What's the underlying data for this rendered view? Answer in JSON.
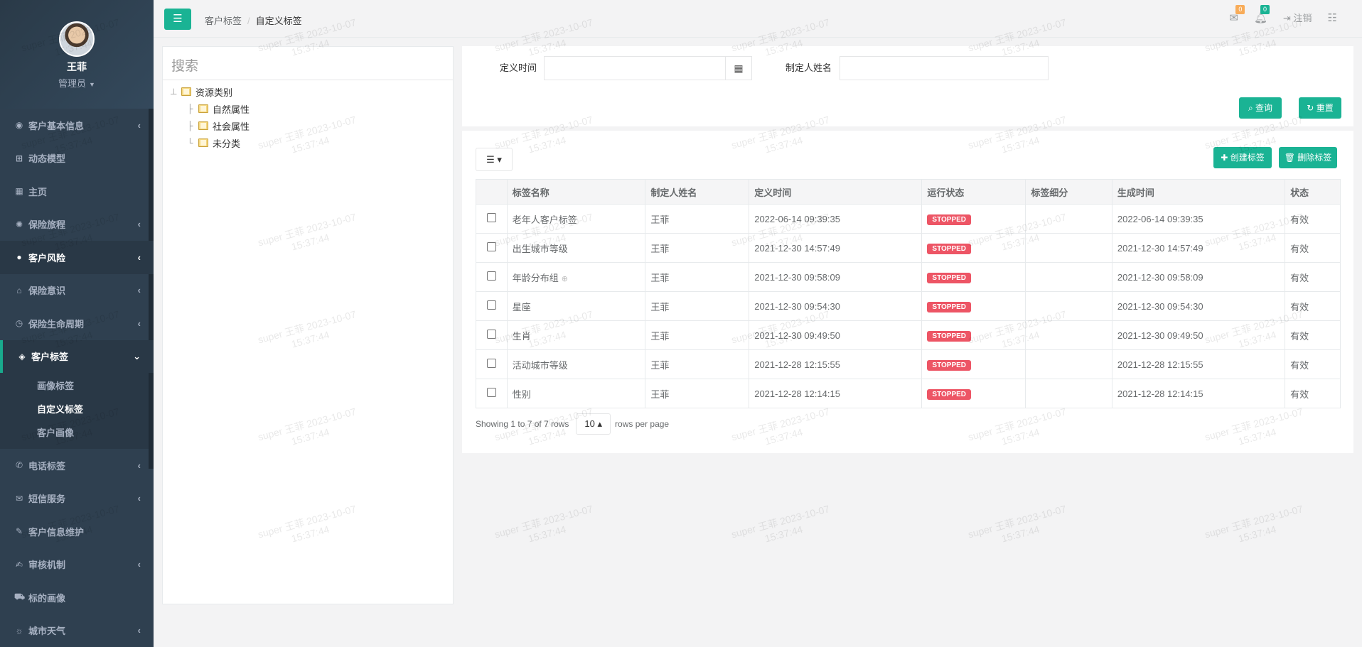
{
  "user": {
    "name": "王菲",
    "role": "管理员"
  },
  "nav": [
    {
      "label": "客户基本信息",
      "icon": "user-circle-icon",
      "glyph": "◉",
      "arrow": "‹",
      "state": ""
    },
    {
      "label": "动态模型",
      "icon": "sitemap-icon",
      "glyph": "⊞",
      "arrow": "",
      "state": ""
    },
    {
      "label": "主页",
      "icon": "grid-icon",
      "glyph": "▦",
      "arrow": "",
      "state": ""
    },
    {
      "label": "保险旅程",
      "icon": "spinner-icon",
      "glyph": "✺",
      "arrow": "‹",
      "state": ""
    },
    {
      "label": "客户风险",
      "icon": "bomb-icon",
      "glyph": "●",
      "arrow": "‹",
      "state": "active"
    },
    {
      "label": "保险意识",
      "icon": "graduation-cap-icon",
      "glyph": "⌂",
      "arrow": "‹",
      "state": ""
    },
    {
      "label": "保险生命周期",
      "icon": "clock-icon",
      "glyph": "◷",
      "arrow": "‹",
      "state": ""
    },
    {
      "label": "客户标签",
      "icon": "tags-icon",
      "glyph": "◈",
      "arrow": "⌄",
      "state": "open"
    }
  ],
  "subnav": [
    {
      "label": "画像标签",
      "current": false
    },
    {
      "label": "自定义标签",
      "current": true
    },
    {
      "label": "客户画像",
      "current": false
    }
  ],
  "nav_bottom": [
    {
      "label": "电话标签",
      "icon": "phone-volume-icon",
      "glyph": "✆",
      "arrow": "‹"
    },
    {
      "label": "短信服务",
      "icon": "envelope-icon",
      "glyph": "✉",
      "arrow": "‹"
    },
    {
      "label": "客户信息维护",
      "icon": "wrench-icon",
      "glyph": "✎",
      "arrow": ""
    },
    {
      "label": "审核机制",
      "icon": "edit-icon",
      "glyph": "✍",
      "arrow": "‹"
    },
    {
      "label": "标的画像",
      "icon": "car-icon",
      "glyph": "⛟",
      "arrow": ""
    },
    {
      "label": "城市天气",
      "icon": "sun-icon",
      "glyph": "☼",
      "arrow": "‹"
    }
  ],
  "breadcrumb": {
    "parent": "客户标签",
    "current": "自定义标签"
  },
  "topbar": {
    "mail_count": "0",
    "alert_count": "0",
    "logout": "注销"
  },
  "tree": {
    "search_placeholder": "搜索",
    "root": "资源类别",
    "children": [
      "自然属性",
      "社会属性",
      "未分类"
    ]
  },
  "form": {
    "define_time_label": "定义时间",
    "creator_label": "制定人姓名",
    "search_btn": "查询",
    "reset_btn": "重置"
  },
  "toolbar": {
    "create_btn": "创建标签",
    "delete_btn": "删除标签"
  },
  "table": {
    "columns": [
      "标签名称",
      "制定人姓名",
      "定义时间",
      "运行状态",
      "标签细分",
      "生成时间",
      "状态"
    ],
    "rows": [
      {
        "name": "老年人客户标签",
        "creator": "王菲",
        "defined": "2022-06-14 09:39:35",
        "run": "STOPPED",
        "detail": "",
        "generated": "2022-06-14 09:39:35",
        "status": "有效",
        "plus": ""
      },
      {
        "name": "出生城市等级",
        "creator": "王菲",
        "defined": "2021-12-30 14:57:49",
        "run": "STOPPED",
        "detail": "",
        "generated": "2021-12-30 14:57:49",
        "status": "有效",
        "plus": ""
      },
      {
        "name": "年龄分布组",
        "creator": "王菲",
        "defined": "2021-12-30 09:58:09",
        "run": "STOPPED",
        "detail": "",
        "generated": "2021-12-30 09:58:09",
        "status": "有效",
        "plus": "⊕"
      },
      {
        "name": "星座",
        "creator": "王菲",
        "defined": "2021-12-30 09:54:30",
        "run": "STOPPED",
        "detail": "",
        "generated": "2021-12-30 09:54:30",
        "status": "有效",
        "plus": ""
      },
      {
        "name": "生肖",
        "creator": "王菲",
        "defined": "2021-12-30 09:49:50",
        "run": "STOPPED",
        "detail": "",
        "generated": "2021-12-30 09:49:50",
        "status": "有效",
        "plus": ""
      },
      {
        "name": "活动城市等级",
        "creator": "王菲",
        "defined": "2021-12-28 12:15:55",
        "run": "STOPPED",
        "detail": "",
        "generated": "2021-12-28 12:15:55",
        "status": "有效",
        "plus": ""
      },
      {
        "name": "性别",
        "creator": "王菲",
        "defined": "2021-12-28 12:14:15",
        "run": "STOPPED",
        "detail": "",
        "generated": "2021-12-28 12:14:15",
        "status": "有效",
        "plus": ""
      }
    ]
  },
  "pager": {
    "summary": "Showing 1 to 7 of 7 rows",
    "page_size": "10",
    "suffix": "rows per page"
  },
  "watermark": {
    "line1": "super 王菲 2023-10-07",
    "line2": "15:37:44"
  },
  "colors": {
    "primary": "#1ab394",
    "sidebar": "#2f4050",
    "danger": "#ed5565",
    "warning": "#f8ac59"
  }
}
